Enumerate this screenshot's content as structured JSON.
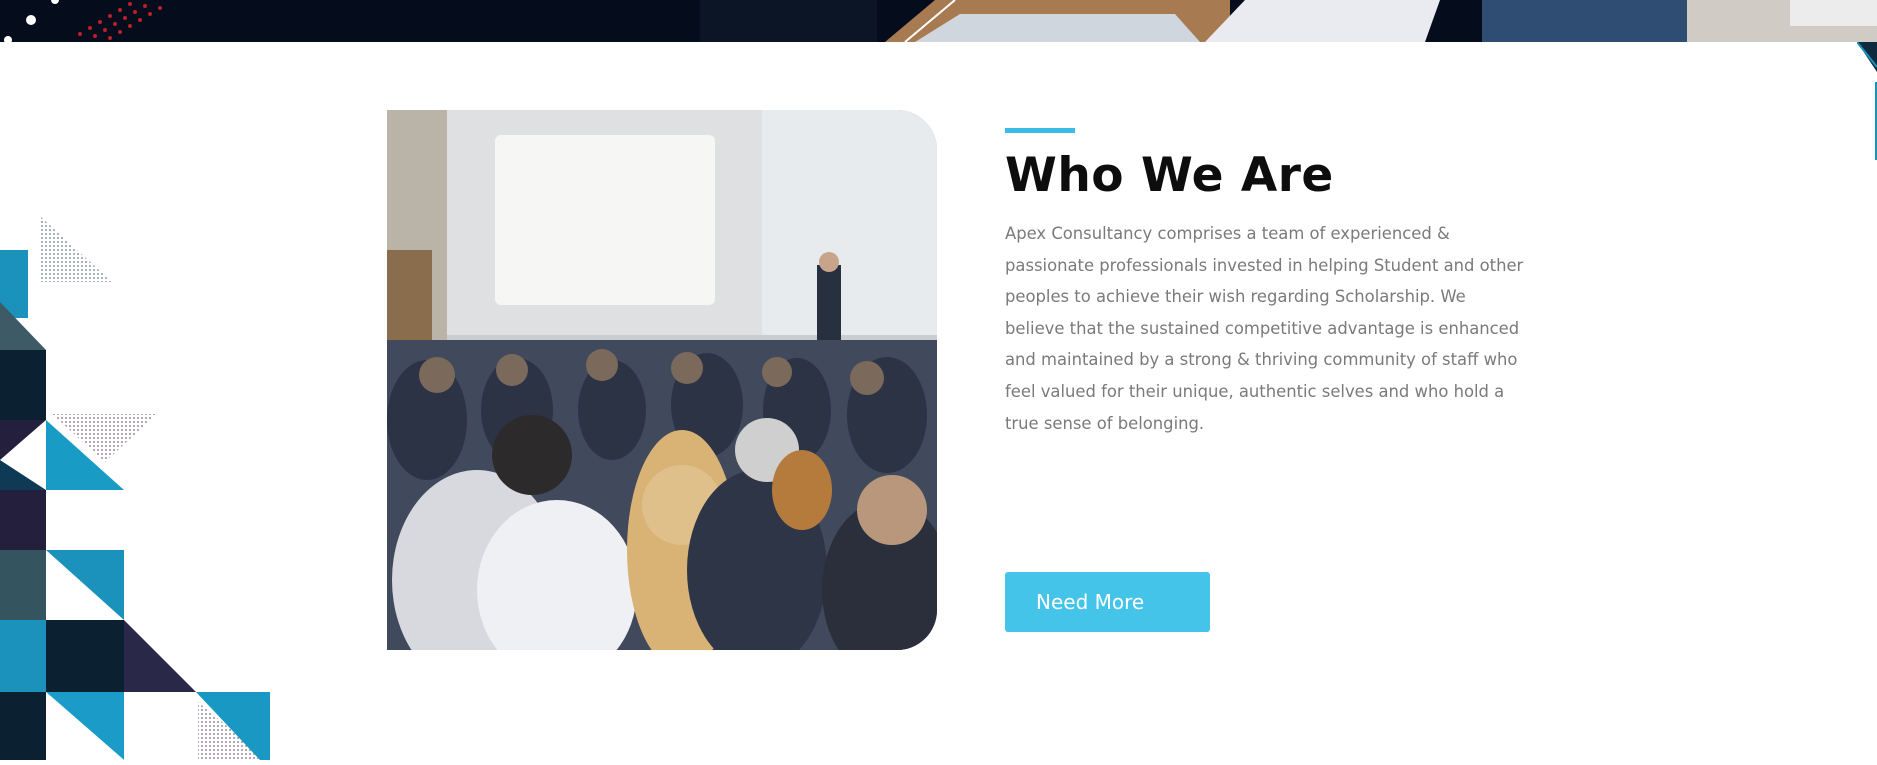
{
  "about": {
    "heading": "Who We Are",
    "description": "Apex Consultancy comprises a team of experienced & passionate professionals invested in helping Student and other peoples to achieve their wish regarding Scholarship. We believe that the sustained competitive advantage is enhanced and maintained by a strong & thriving community of staff who feel valued for their unique, authentic selves and who hold a true sense of belonging.",
    "cta_label": "Need More"
  },
  "colors": {
    "accent": "#3bbbe5",
    "button": "#45c4ea",
    "heading": "#0d0d0d",
    "body_text": "#7a7a7a",
    "dark_navy": "#050d1c"
  },
  "images": {
    "hero": "conference-hero-image",
    "photo": "seminar-audience-photo"
  }
}
